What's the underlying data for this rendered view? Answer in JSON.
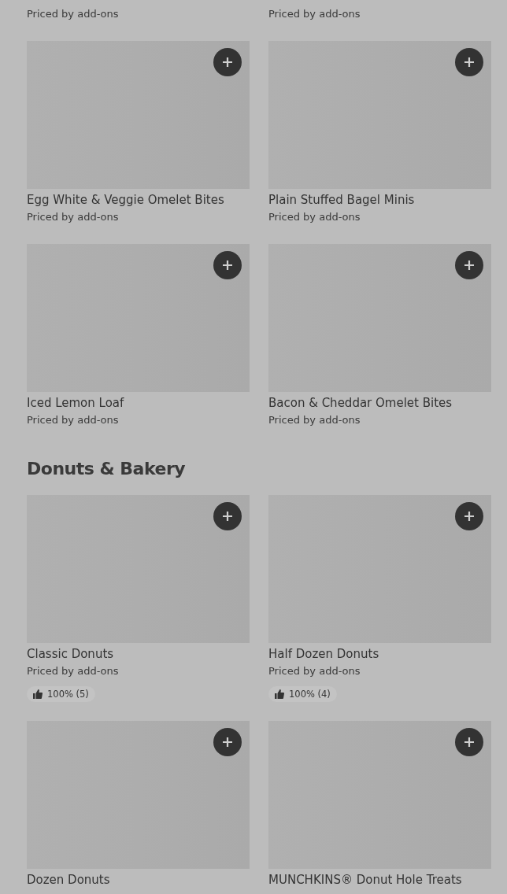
{
  "sections": [
    {
      "items": [
        {
          "kind": "partial",
          "subtitle": "Priced by add-ons"
        },
        {
          "kind": "partial",
          "subtitle": "Priced by add-ons"
        }
      ]
    },
    {
      "items": [
        {
          "kind": "product",
          "name": "Egg White & Veggie Omelet Bites",
          "subtitle": "Priced by add-ons"
        },
        {
          "kind": "product",
          "name": "Plain Stuffed Bagel Minis",
          "subtitle": "Priced by add-ons"
        },
        {
          "kind": "product",
          "name": "Iced Lemon Loaf",
          "subtitle": "Priced by add-ons"
        },
        {
          "kind": "product",
          "name": "Bacon & Cheddar Omelet Bites",
          "subtitle": "Priced by add-ons"
        }
      ]
    },
    {
      "title": "Donuts & Bakery",
      "items": [
        {
          "kind": "product",
          "name": "Classic Donuts",
          "subtitle": "Priced by add-ons",
          "rating": "100% (5)"
        },
        {
          "kind": "product",
          "name": "Half Dozen Donuts",
          "subtitle": "Priced by add-ons",
          "rating": "100% (4)"
        },
        {
          "kind": "product",
          "name": "Dozen Donuts"
        },
        {
          "kind": "product",
          "name": "MUNCHKINS® Donut Hole Treats"
        }
      ]
    }
  ]
}
